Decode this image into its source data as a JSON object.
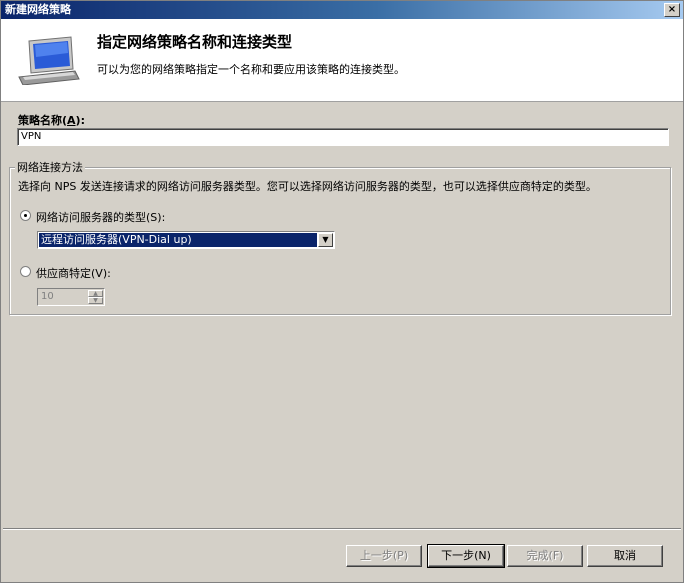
{
  "window": {
    "title": "新建网络策略",
    "close_glyph": "×"
  },
  "header": {
    "title": "指定网络策略名称和连接类型",
    "description": "可以为您的网络策略指定一个名称和要应用该策略的连接类型。"
  },
  "policy_name": {
    "label": "策略名称",
    "accel": "A",
    "value": "VPN"
  },
  "connection_method": {
    "legend": "网络连接方法",
    "description": "选择向 NPS 发送连接请求的网络访问服务器类型。您可以选择网络访问服务器的类型，也可以选择供应商特定的类型。",
    "option_nas_type": {
      "label": "网络访问服务器的类型(S):",
      "selected": true
    },
    "nas_type_select": {
      "value": "远程访问服务器(VPN-Dial up)"
    },
    "option_vendor": {
      "label": "供应商特定(V):",
      "selected": false
    },
    "vendor_spin": {
      "value": "10",
      "enabled": false
    }
  },
  "buttons": {
    "back": "上一步(P)",
    "next": "下一步(N)",
    "finish": "完成(F)",
    "cancel": "取消"
  },
  "colors": {
    "title_gradient_start": "#0a246a",
    "selection": "#0a246a",
    "face": "#d4d0c8"
  }
}
